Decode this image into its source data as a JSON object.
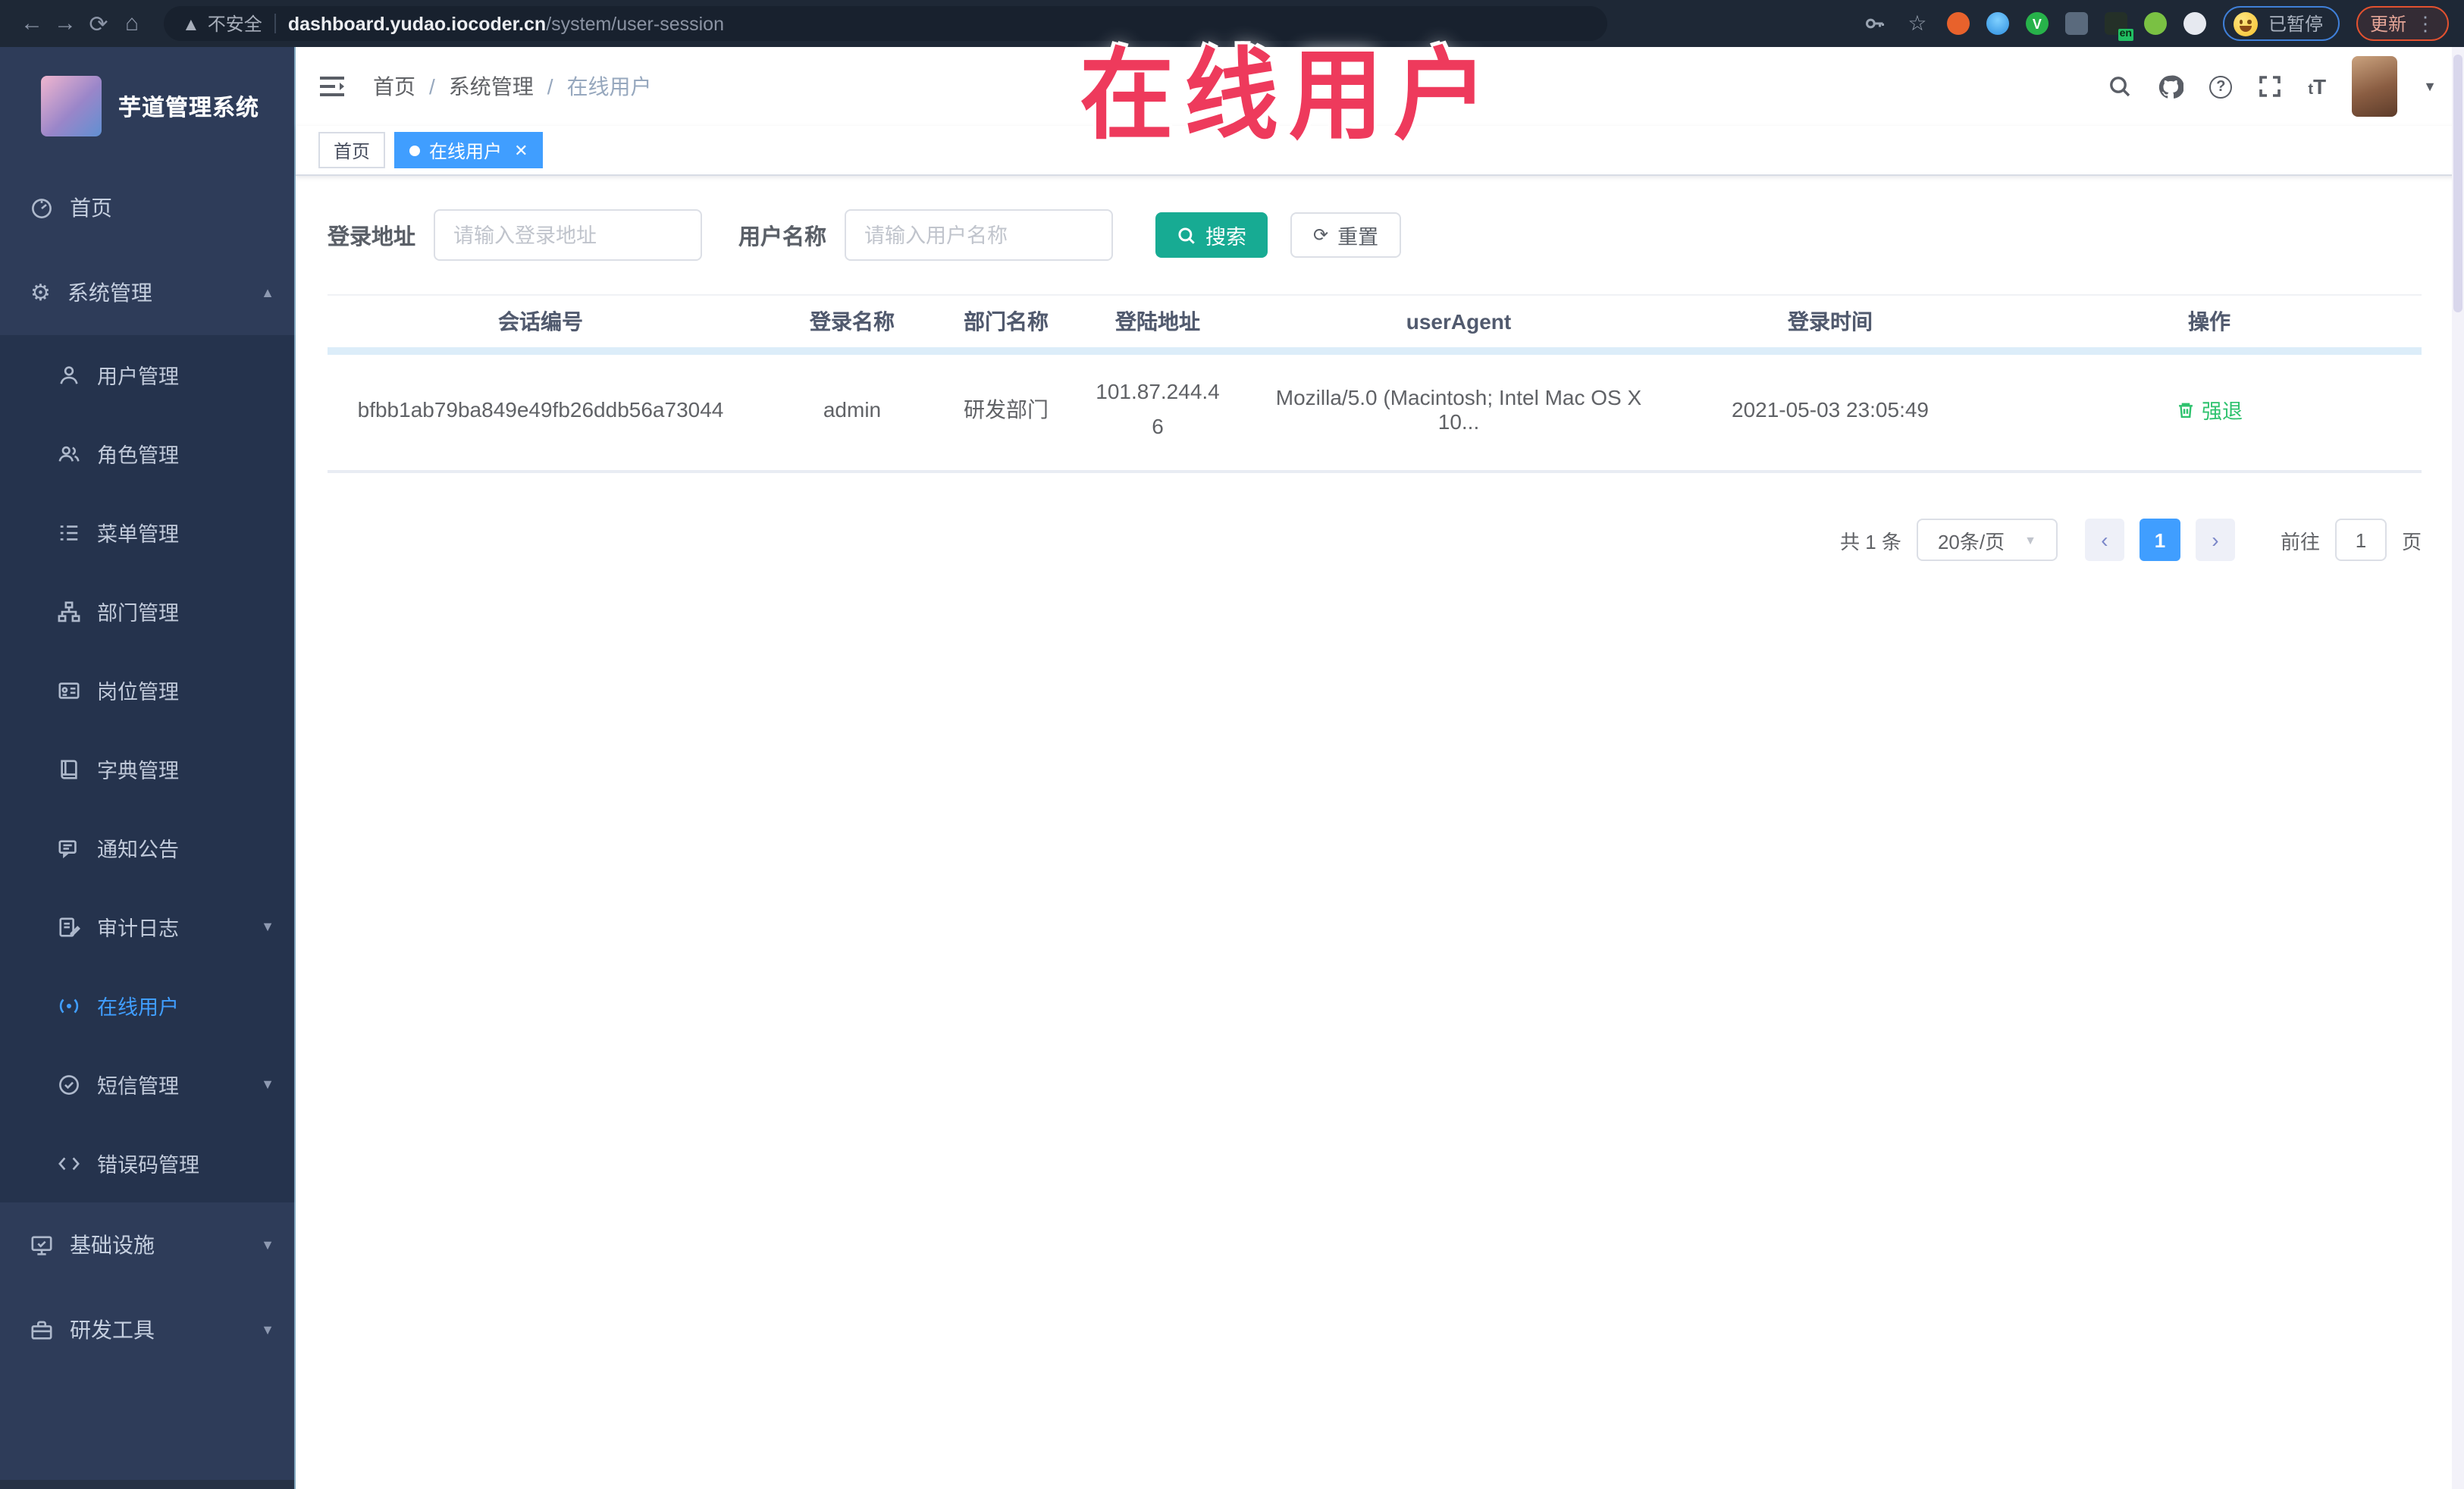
{
  "browser": {
    "security_label": "不安全",
    "url_host": "dashboard.yudao.iocoder.cn",
    "url_path": "/system/user-session",
    "paused_badge": "已暂停",
    "update_button": "更新",
    "en_badge": "en"
  },
  "overlay": {
    "title": "在线用户"
  },
  "sidebar": {
    "logo_title": "芋道管理系统",
    "items": [
      {
        "label": "首页"
      },
      {
        "label": "系统管理",
        "children": [
          "用户管理",
          "角色管理",
          "菜单管理",
          "部门管理",
          "岗位管理",
          "字典管理",
          "通知公告",
          "审计日志",
          "在线用户",
          "短信管理",
          "错误码管理"
        ]
      },
      {
        "label": "基础设施"
      },
      {
        "label": "研发工具"
      }
    ]
  },
  "navbar": {
    "breadcrumb": [
      "首页",
      "系统管理",
      "在线用户"
    ],
    "font_icon": "tT"
  },
  "tags": {
    "items": [
      {
        "label": "首页"
      },
      {
        "label": "在线用户"
      }
    ]
  },
  "filters": {
    "address_label": "登录地址",
    "address_placeholder": "请输入登录地址",
    "name_label": "用户名称",
    "name_placeholder": "请输入用户名称",
    "search": "搜索",
    "reset": "重置"
  },
  "table": {
    "columns": [
      "会话编号",
      "登录名称",
      "部门名称",
      "登陆地址",
      "userAgent",
      "登录时间",
      "操作"
    ],
    "rows": [
      {
        "session": "bfbb1ab79ba849e49fb26ddb56a73044",
        "name": "admin",
        "dept": "研发部门",
        "address": "101.87.244.46",
        "agent": "Mozilla/5.0 (Macintosh; Intel Mac OS X 10...",
        "time": "2021-05-03 23:05:49",
        "action": "强退"
      }
    ]
  },
  "pagination": {
    "total": "共 1 条",
    "size": "20条/页",
    "page": "1",
    "goto": "前往",
    "goto_value": "1",
    "unit": "页"
  },
  "colors": {
    "accent": "#409EFF",
    "search_button": "#17ab93",
    "action_link": "#2ec26e",
    "overlay_red": "#ee3a5c",
    "sidebar_bg": "#2e3c59",
    "submenu_bg": "#25334d"
  }
}
